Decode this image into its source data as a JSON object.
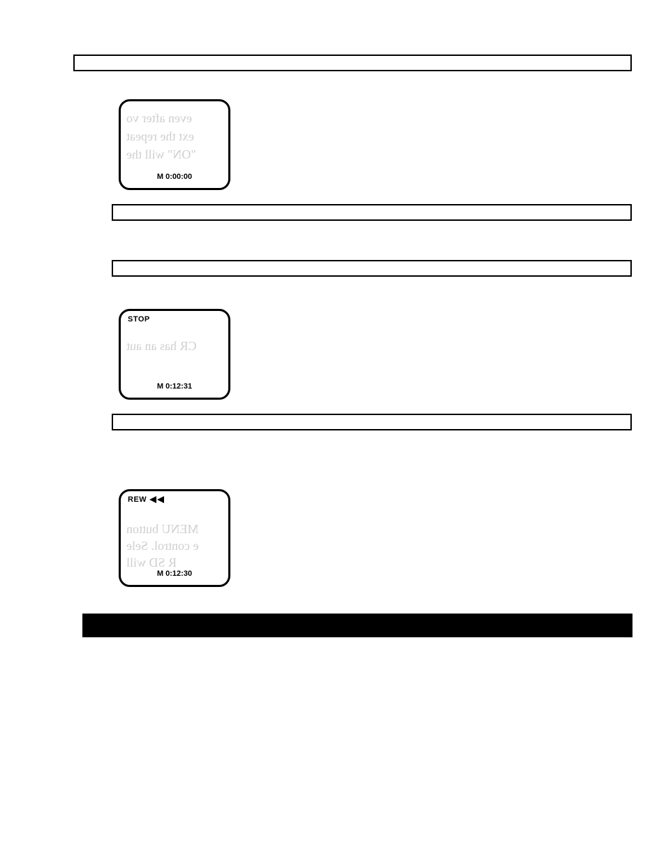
{
  "screen1": {
    "time": "M  0:00:00"
  },
  "screen2": {
    "status": "STOP",
    "time": "M  0:12:31"
  },
  "screen3": {
    "status": "REW",
    "time": "M  0:12:30"
  },
  "ghost": {
    "g1": "even after vo",
    "g2": "ext the repeat",
    "g3": "\"ON\" will the",
    "g4": "CR has an aut",
    "g5": "",
    "g6": "MENU button",
    "g7": "e control. Sele",
    "g8": "R SD will"
  }
}
